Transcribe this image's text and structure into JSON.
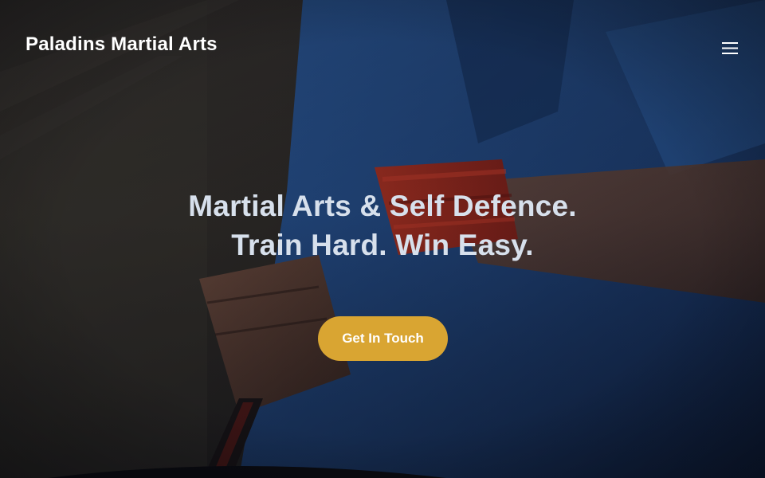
{
  "header": {
    "brand_name": "Paladins Martial Arts",
    "menu_icon": "hamburger-menu-icon"
  },
  "hero": {
    "headline_line1": "Martial Arts & Self Defence.",
    "headline_line2": "Train Hard. Win Easy.",
    "cta_label": "Get In Touch",
    "background_image": "fighter-wrapping-hands-photo"
  },
  "colors": {
    "accent": "#d9a532",
    "headline_text": "#d7e0ec",
    "brand_text": "#ffffff",
    "shirt_blue": "#1f3f73",
    "hand_wrap_red": "#9e2a20"
  }
}
